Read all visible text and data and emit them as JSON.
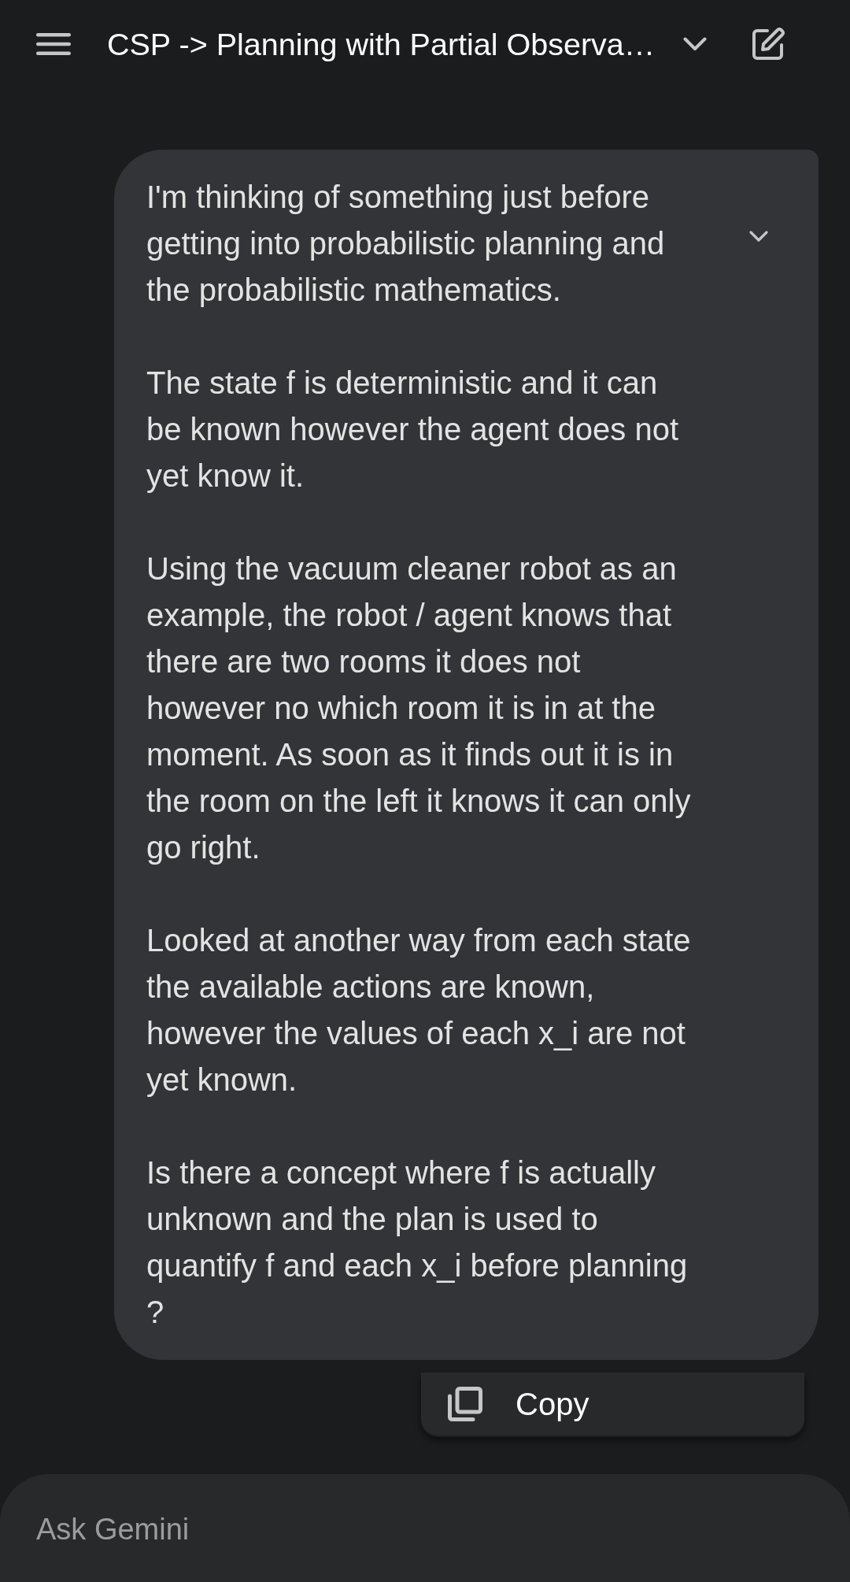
{
  "top_bar": {
    "title": "CSP -> Planning with Partial Observa…"
  },
  "message": {
    "paragraphs": [
      "I'm thinking of something just before getting into probabilistic planning and the probabilistic mathematics.",
      "The state f is deterministic and it can be known however the agent does not yet know it.",
      "Using the vacuum cleaner robot as an example, the robot / agent knows that there are two rooms it does not however no which room it is in at the moment. As soon as it finds out it is in the room on the left it knows it can only go right.",
      "Looked at another way from each state the available actions are known, however the values of each x_i are not yet known.",
      "Is there a concept where f is actually unknown and the plan is used to quantify f and each x_i before planning ?"
    ]
  },
  "context_menu": {
    "items": [
      {
        "label": "Copy"
      }
    ]
  },
  "input": {
    "placeholder": "Ask Gemini"
  }
}
